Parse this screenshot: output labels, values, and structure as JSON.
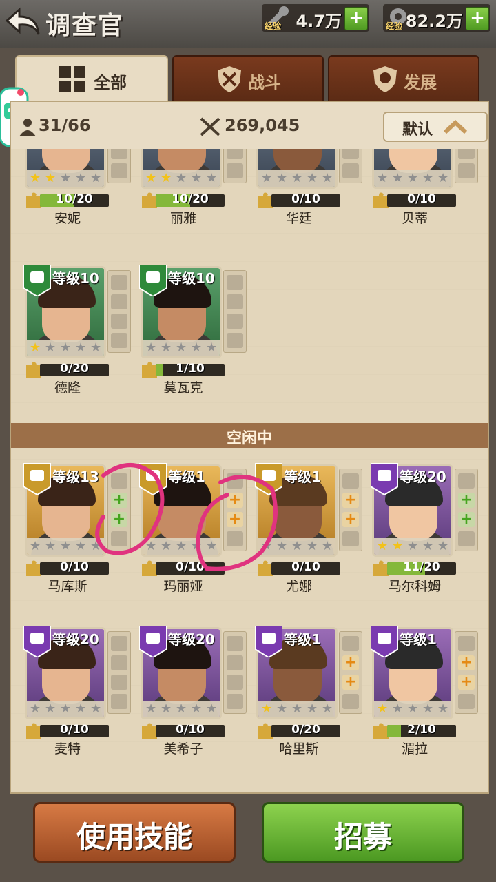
{
  "header": {
    "title": "调查官"
  },
  "resources": [
    {
      "label": "经验",
      "value": "4.7万"
    },
    {
      "label": "经验",
      "value": "82.2万"
    }
  ],
  "tabs": [
    {
      "label": "全部",
      "icon": "grid-icon"
    },
    {
      "label": "战斗",
      "icon": "combat-icon"
    },
    {
      "label": "发展",
      "icon": "develop-icon"
    }
  ],
  "stats": {
    "count": "31/66",
    "power": "269,045",
    "sort_label": "默认"
  },
  "section_idle": "空闲中",
  "heroes_active": [
    {
      "name": "安妮",
      "progress": "10/20",
      "fill": 0.5,
      "stars": 1.5,
      "bg": "slate"
    },
    {
      "name": "丽雅",
      "progress": "10/20",
      "fill": 0.5,
      "stars": 1.5,
      "bg": "slate"
    },
    {
      "name": "华廷",
      "progress": "0/10",
      "fill": 0,
      "stars": 0,
      "bg": "slate"
    },
    {
      "name": "贝蒂",
      "progress": "0/10",
      "fill": 0,
      "stars": 0,
      "bg": "slate"
    },
    {
      "name": "德隆",
      "level": "等级10",
      "progress": "0/20",
      "fill": 0,
      "stars": 1,
      "bg": "green"
    },
    {
      "name": "莫瓦克",
      "level": "等级10",
      "progress": "1/10",
      "fill": 0.1,
      "stars": 0,
      "bg": "green"
    }
  ],
  "heroes_idle": [
    {
      "name": "马库斯",
      "level": "等级13",
      "progress": "0/10",
      "fill": 0,
      "stars": 0,
      "bg": "gold",
      "plus": "green"
    },
    {
      "name": "玛丽娅",
      "level": "等级1",
      "progress": "0/10",
      "fill": 0,
      "stars": 0,
      "bg": "gold",
      "plus": "orange"
    },
    {
      "name": "尤娜",
      "level": "等级1",
      "progress": "0/10",
      "fill": 0,
      "stars": 0,
      "bg": "gold",
      "plus": "orange"
    },
    {
      "name": "马尔科姆",
      "level": "等级20",
      "progress": "11/20",
      "fill": 0.55,
      "stars": 1.5,
      "bg": "purple",
      "plus": "green"
    },
    {
      "name": "麦特",
      "level": "等级20",
      "progress": "0/10",
      "fill": 0,
      "stars": 0,
      "bg": "purple",
      "plus": "none"
    },
    {
      "name": "美希子",
      "level": "等级20",
      "progress": "0/10",
      "fill": 0,
      "stars": 0,
      "bg": "purple",
      "plus": "none"
    },
    {
      "name": "哈里斯",
      "level": "等级1",
      "progress": "0/20",
      "fill": 0,
      "stars": 1,
      "bg": "purple",
      "plus": "orange"
    },
    {
      "name": "湄拉",
      "level": "等级1",
      "progress": "2/10",
      "fill": 0.2,
      "stars": 0.5,
      "bg": "purple",
      "plus": "orange"
    }
  ],
  "buttons": {
    "skill": "使用技能",
    "recruit": "招募"
  }
}
